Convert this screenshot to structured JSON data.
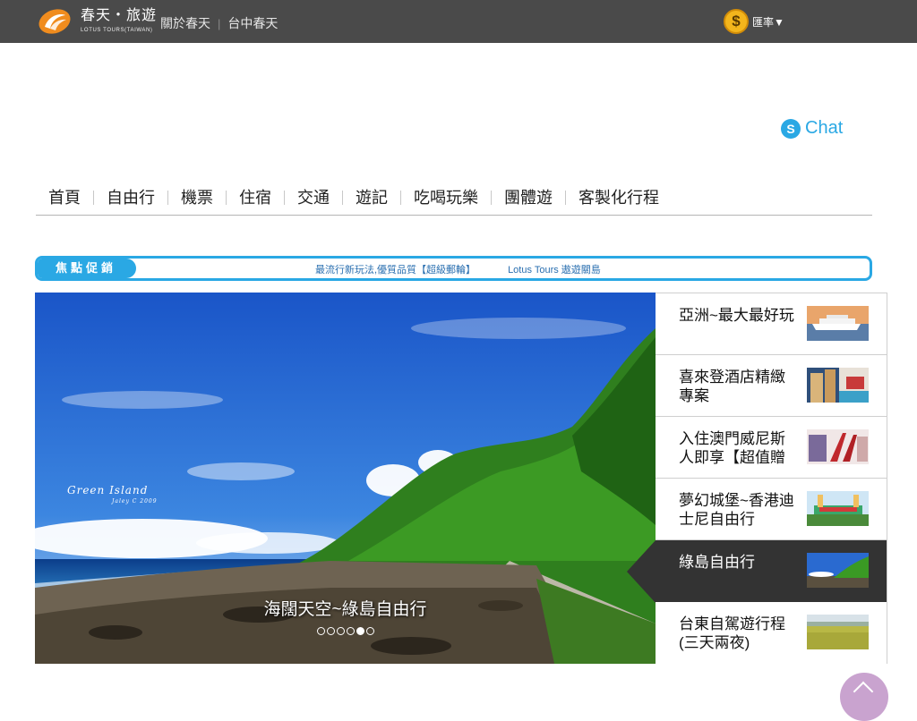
{
  "header": {
    "brand_cn": "春天・旅遊",
    "brand_en": "LOTUS TOURS(TAIWAN)",
    "links": [
      "關於春天",
      "台中春天"
    ],
    "currency_symbol": "$",
    "currency_label": "匯率▼"
  },
  "chat": {
    "label": "Chat",
    "icon": "skype-icon"
  },
  "nav": {
    "items": [
      "首頁",
      "自由行",
      "機票",
      "住宿",
      "交通",
      "遊記",
      "吃喝玩樂",
      "團體遊",
      "客製化行程"
    ]
  },
  "promo": {
    "label": "焦點促銷",
    "links": [
      "最流行新玩法,優質品質【超級郵輪】",
      "Lotus Tours 遨遊關島"
    ]
  },
  "hero": {
    "caption": "海闊天空~綠島自由行",
    "watermark_title": "Green Island",
    "watermark_sub": "Jaley C 2009",
    "slide_count": 6,
    "active_slide": 5
  },
  "side_list": {
    "items": [
      {
        "label": "亞洲~最大最好玩",
        "thumb": "cruise-ship",
        "active": false
      },
      {
        "label": "喜來登酒店精緻專案",
        "thumb": "hotel",
        "active": false
      },
      {
        "label": "入住澳門威尼斯人即享【超值贈",
        "thumb": "macau-venetian",
        "active": false
      },
      {
        "label": "夢幻城堡~香港迪士尼自由行",
        "thumb": "disneyland",
        "active": false
      },
      {
        "label": "綠島自由行",
        "thumb": "green-island",
        "active": true
      },
      {
        "label": "台東自駕遊行程(三天兩夜)",
        "thumb": "rice-field",
        "active": false
      }
    ]
  },
  "colors": {
    "topbar": "#4a4a4a",
    "accent": "#2aa8e4",
    "active_item": "#333333",
    "logo_orange": "#f08c1e"
  }
}
